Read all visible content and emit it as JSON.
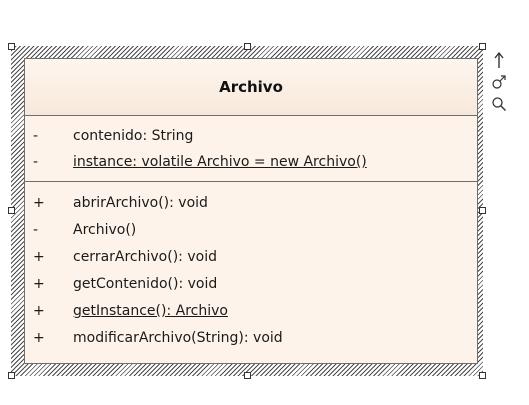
{
  "class": {
    "name": "Archivo",
    "attributes": [
      {
        "visibility": "-",
        "text": "contenido: String",
        "static": false
      },
      {
        "visibility": "-",
        "text": "instance: volatile Archivo = new Archivo()",
        "static": true
      }
    ],
    "operations": [
      {
        "visibility": "+",
        "text": "abrirArchivo(): void",
        "static": false
      },
      {
        "visibility": "-",
        "text": "Archivo()",
        "static": false
      },
      {
        "visibility": "+",
        "text": "cerrarArchivo(): void",
        "static": false
      },
      {
        "visibility": "+",
        "text": "getContenido(): void",
        "static": false
      },
      {
        "visibility": "+",
        "text": "getInstance(): Archivo",
        "static": true
      },
      {
        "visibility": "+",
        "text": "modificarArchivo(String): void",
        "static": false
      }
    ]
  },
  "tools": [
    {
      "name": "arrow-up-icon"
    },
    {
      "name": "link-icon"
    },
    {
      "name": "search-icon"
    }
  ],
  "colors": {
    "class_fill": "#fdf1e6",
    "border": "#6e6e6e"
  }
}
